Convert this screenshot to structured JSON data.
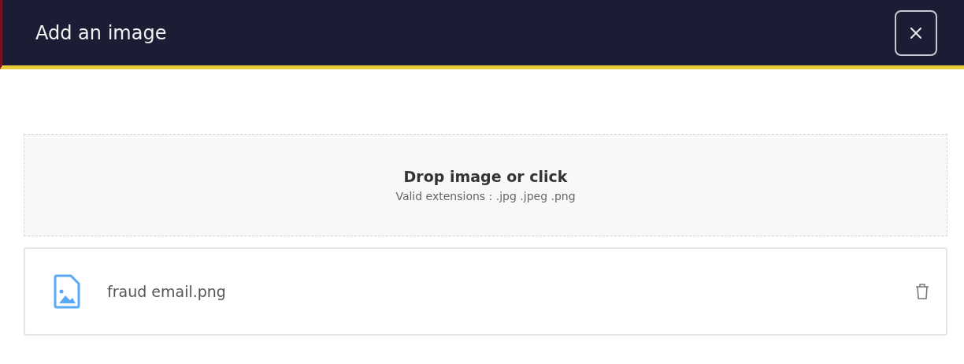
{
  "dialog": {
    "title": "Add an image"
  },
  "dropzone": {
    "title": "Drop image or click",
    "hint": "Valid extensions : .jpg .jpeg .png"
  },
  "files": [
    {
      "name": "fraud email.png"
    }
  ]
}
